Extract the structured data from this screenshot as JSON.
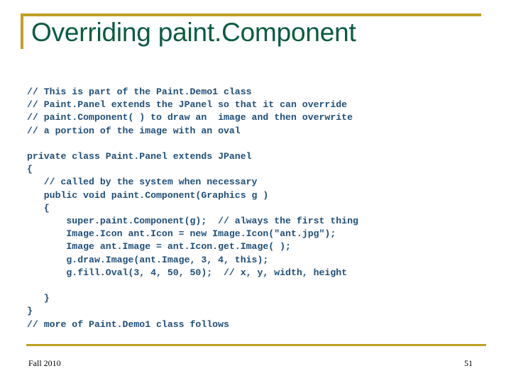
{
  "slide": {
    "title": "Overriding paint.Component",
    "accent_color": "#bfa024",
    "title_color": "#0a5c3e",
    "code_color": "#1f4e79",
    "background_color": "#ffffff"
  },
  "code": {
    "lines": [
      "// This is part of the Paint.Demo1 class",
      "// Paint.Panel extends the JPanel so that it can override",
      "// paint.Component( ) to draw an  image and then overwrite",
      "// a portion of the image with an oval",
      "",
      "private class Paint.Panel extends JPanel",
      "{",
      "   // called by the system when necessary",
      "   public void paint.Component(Graphics g )",
      "   {",
      "       super.paint.Component(g);  // always the first thing",
      "       Image.Icon ant.Icon = new Image.Icon(\"ant.jpg\");",
      "       Image ant.Image = ant.Icon.get.Image( );",
      "       g.draw.Image(ant.Image, 3, 4, this);",
      "       g.fill.Oval(3, 4, 50, 50);  // x, y, width, height",
      "",
      "   }",
      "}",
      "// more of Paint.Demo1 class follows"
    ]
  },
  "footer": {
    "date": "Fall 2010",
    "page_number": "51"
  }
}
